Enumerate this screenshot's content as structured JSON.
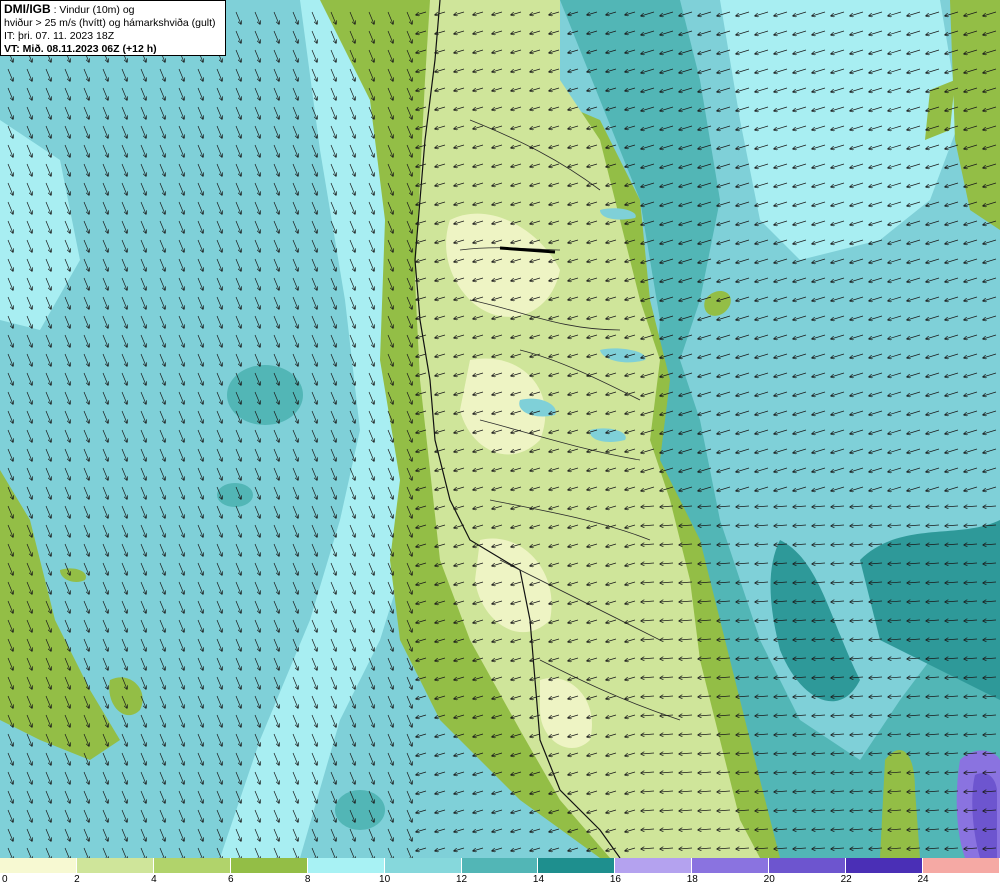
{
  "header": {
    "org": "DMI/IGB",
    "line1_rest": " : Vindur (10m) og",
    "line2": "hviður > 25 m/s (hvítt) og hámarkshviða (gult)",
    "line3": "IT: þri. 07. 11. 2023 18Z",
    "line4": "VT: Mið. 08.11.2023 06Z (+12 h)"
  },
  "legend": {
    "tick_labels": [
      "0",
      "2",
      "4",
      "6",
      "8",
      "10",
      "12",
      "14",
      "16",
      "18",
      "20",
      "22",
      "24"
    ],
    "colors": [
      "#f7f9d2",
      "#cfe59a",
      "#b1d36b",
      "#93be46",
      "#a8f2f4",
      "#86d8dc",
      "#52b6b6",
      "#1e8f8e",
      "#b4a2ef",
      "#8a73e0",
      "#6d55cf",
      "#4a2fb6",
      "#f5a9a4"
    ]
  },
  "map": {
    "colors": {
      "sea_light": "#a8eef2",
      "sea_mid": "#7fd0d8",
      "sea_dark": "#4fb0b4",
      "sea_deep": "#2e9999",
      "land_green": "#93be46",
      "land_light": "#cfe59a",
      "land_pale": "#eef4c4",
      "purple": "#6d55cf",
      "coast": "#111111"
    },
    "wind_arrow_icon": "wind-arrow-icon"
  }
}
